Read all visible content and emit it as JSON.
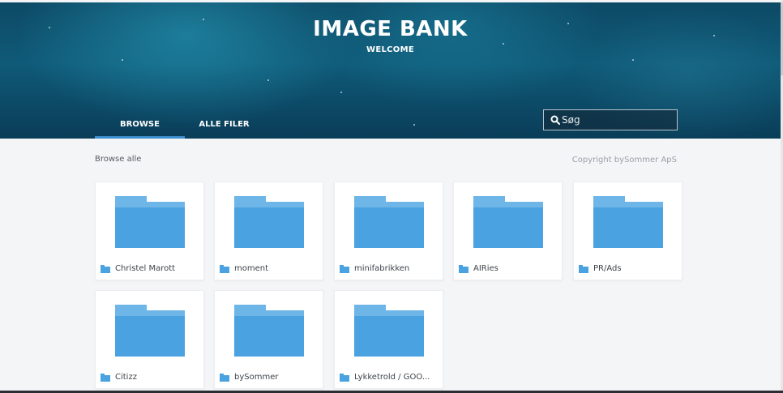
{
  "header": {
    "title": "IMAGE BANK",
    "subtitle": "WELCOME"
  },
  "tabs": [
    {
      "label": "BROWSE",
      "active": true
    },
    {
      "label": "ALLE FILER",
      "active": false
    }
  ],
  "search": {
    "placeholder": "Søg",
    "icon": "search-icon"
  },
  "main": {
    "browse_label": "Browse alle",
    "copyright": "Copyright bySommer ApS"
  },
  "folders": [
    {
      "name": "Christel Marott"
    },
    {
      "name": "moment"
    },
    {
      "name": "minifabrikken"
    },
    {
      "name": "AIRies"
    },
    {
      "name": "PR/Ads"
    },
    {
      "name": "Citizz"
    },
    {
      "name": "bySommer"
    },
    {
      "name": "Lykketrold / GOO..."
    }
  ],
  "colors": {
    "accent": "#3d8fd0",
    "folder_fill": "#4aa3e0",
    "folder_tab": "#6fb6e8"
  }
}
